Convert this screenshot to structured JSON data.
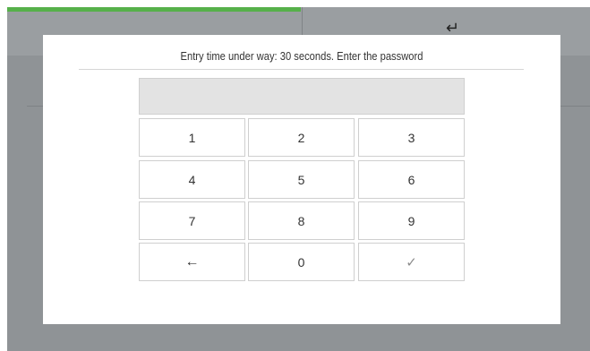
{
  "dialog": {
    "title": "Entry time under way: 30 seconds. Enter the password",
    "display_value": ""
  },
  "keypad": {
    "keys": [
      "1",
      "2",
      "3",
      "4",
      "5",
      "6",
      "7",
      "8",
      "9",
      "←",
      "0",
      "✓"
    ]
  },
  "icons": {
    "top_left": "grid-icon",
    "top_right": "enter-return-icon",
    "backspace": "backspace-arrow-icon",
    "confirm": "check-icon"
  },
  "colors": {
    "accent": "#56b04a",
    "background": "#8f9396",
    "dialog": "#ffffff",
    "display": "#e3e3e3"
  }
}
